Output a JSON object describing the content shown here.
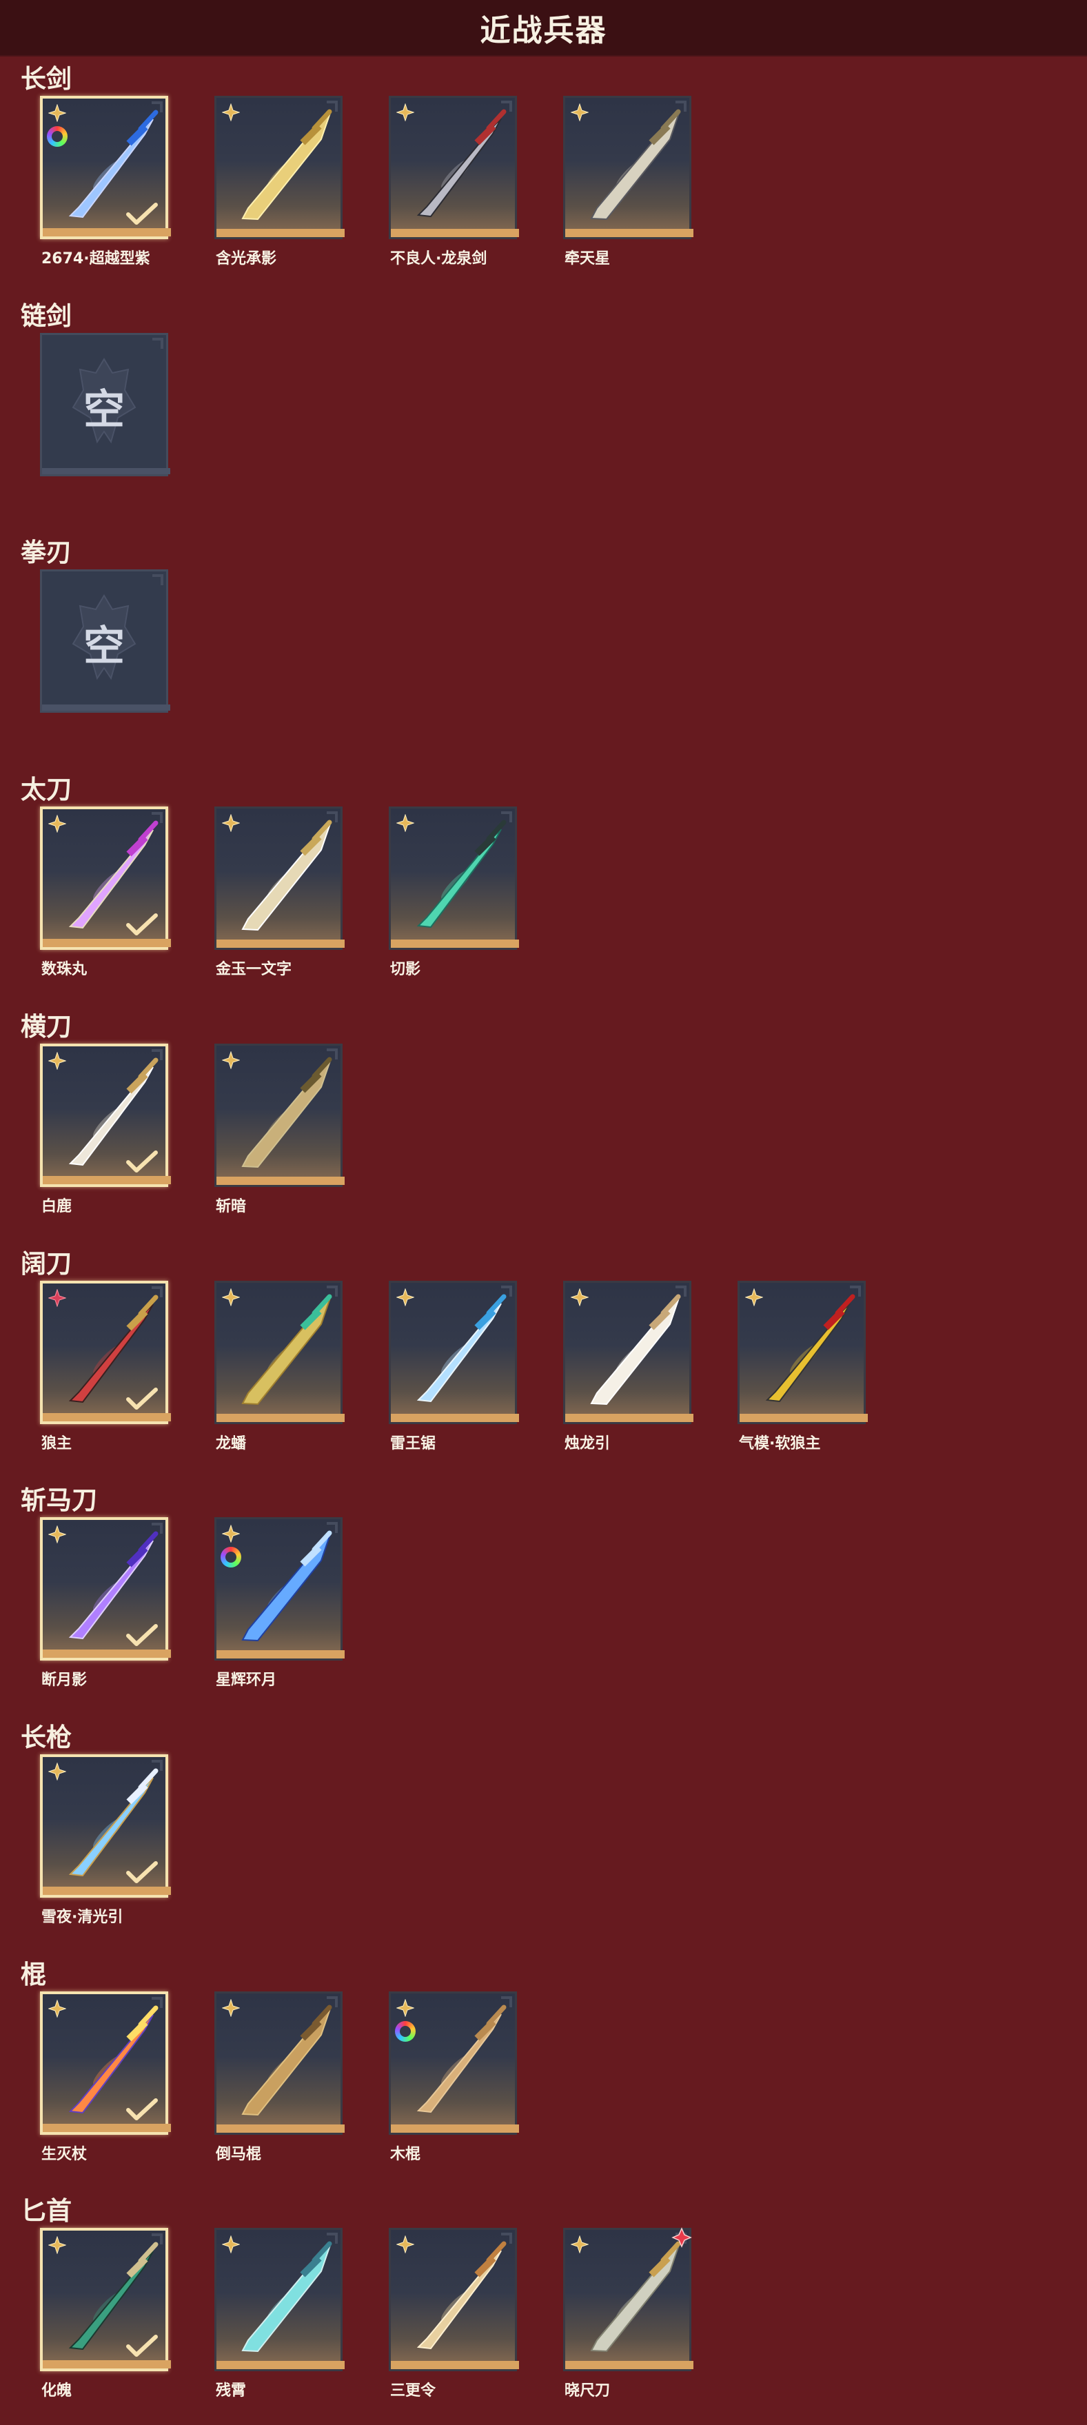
{
  "header": {
    "title": "近战兵器"
  },
  "icons": {
    "star": "four-point-star-icon",
    "ring": "rainbow-ring-icon",
    "check": "check-icon",
    "flower": "red-flower-icon"
  },
  "colors": {
    "background": "#661a1f",
    "header": "#3b1013",
    "card_bar": "#d9a361"
  },
  "categories": [
    {
      "title": "长剑",
      "items": [
        {
          "name": "2674·超越型紫",
          "selected": true,
          "ring": true
        },
        {
          "name": "含光承影"
        },
        {
          "name": "不良人·龙泉剑"
        },
        {
          "name": "牵天星"
        }
      ]
    },
    {
      "title": "链剑",
      "items": [
        {
          "empty": true,
          "label": "空"
        }
      ]
    },
    {
      "title": "拳刃",
      "items": [
        {
          "empty": true,
          "label": "空"
        }
      ]
    },
    {
      "title": "太刀",
      "items": [
        {
          "name": "数珠丸",
          "selected": true
        },
        {
          "name": "金玉一文字"
        },
        {
          "name": "切影"
        }
      ]
    },
    {
      "title": "横刀",
      "items": [
        {
          "name": "白鹿",
          "selected": true
        },
        {
          "name": "斩暗"
        }
      ]
    },
    {
      "title": "阔刀",
      "items": [
        {
          "name": "狼主",
          "selected": true,
          "red_star": true
        },
        {
          "name": "龙蟠"
        },
        {
          "name": "雷王锯"
        },
        {
          "name": "烛龙引"
        },
        {
          "name": "气模·软狼主"
        }
      ]
    },
    {
      "title": "斩马刀",
      "items": [
        {
          "name": "断月影",
          "selected": true
        },
        {
          "name": "星辉环月",
          "ring": true
        }
      ]
    },
    {
      "title": "长枪",
      "items": [
        {
          "name": "雪夜·清光引",
          "selected": true
        }
      ]
    },
    {
      "title": "棍",
      "items": [
        {
          "name": "生灭杖",
          "selected": true
        },
        {
          "name": "倒马棍"
        },
        {
          "name": "木棍",
          "ring": true
        }
      ]
    },
    {
      "title": "匕首",
      "items": [
        {
          "name": "化魄",
          "selected": true
        },
        {
          "name": "残霄"
        },
        {
          "name": "三更令"
        },
        {
          "name": "晓尺刀",
          "flower": true
        }
      ]
    }
  ]
}
